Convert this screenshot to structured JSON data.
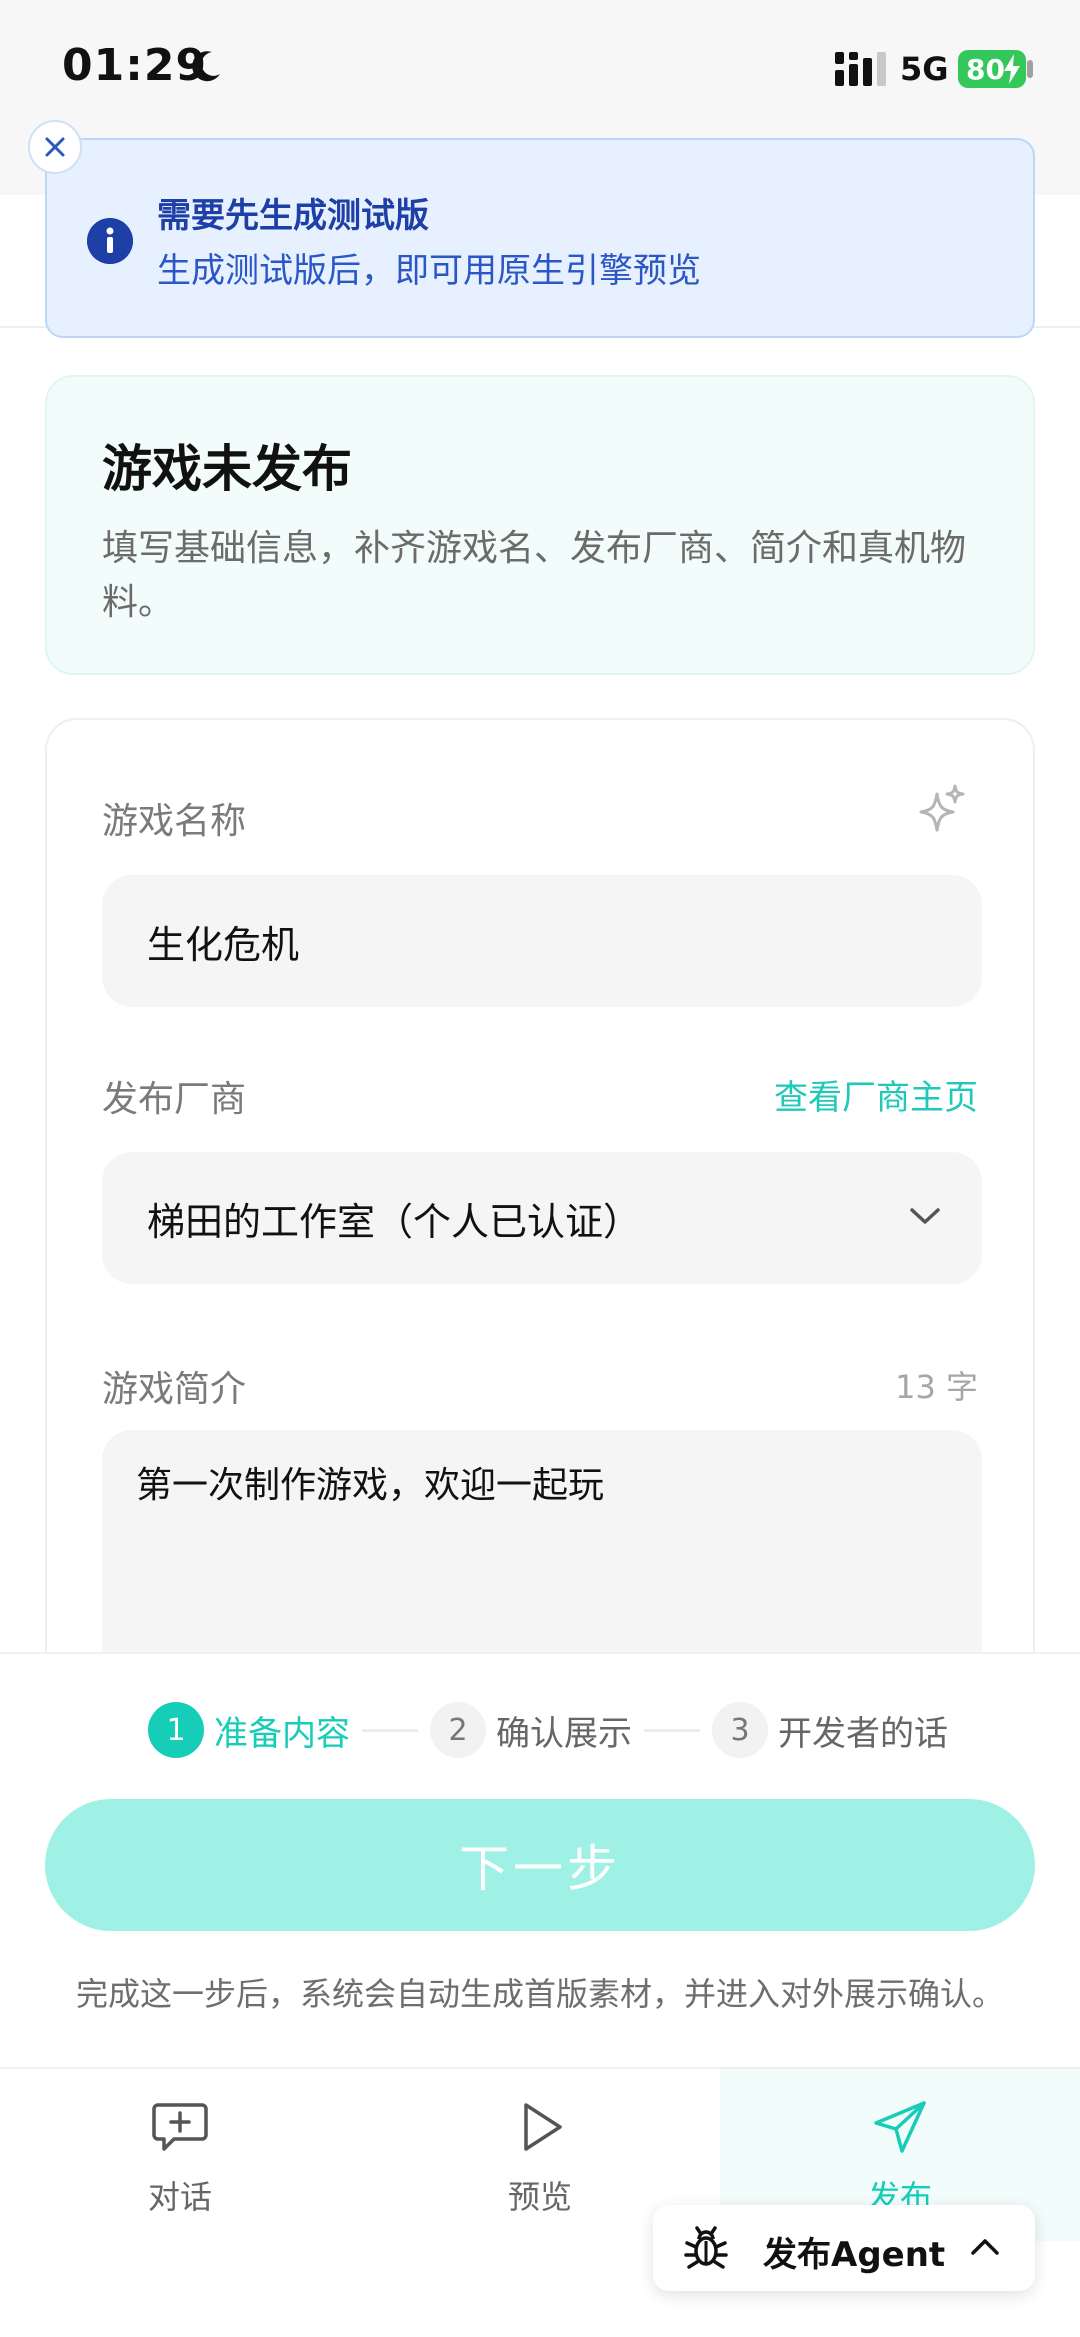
{
  "status_bar": {
    "time": "01:29",
    "network": "5G",
    "battery": "80"
  },
  "toast": {
    "title": "需要先生成测试版",
    "description": "生成测试版后，即可用原生引擎预览"
  },
  "status_card": {
    "title": "游戏未发布",
    "description": "填写基础信息，补齐游戏名、发布厂商、简介和真机物料。"
  },
  "form": {
    "game_name_label": "游戏名称",
    "game_name_value": "生化危机",
    "publisher_label": "发布厂商",
    "publisher_link": "查看厂商主页",
    "publisher_value": "梯田的工作室（个人已认证）",
    "intro_label": "游戏简介",
    "intro_count": "13 字",
    "intro_value": "第一次制作游戏，欢迎一起玩"
  },
  "steps": [
    {
      "num": "1",
      "label": "准备内容",
      "active": true
    },
    {
      "num": "2",
      "label": "确认展示",
      "active": false
    },
    {
      "num": "3",
      "label": "开发者的话",
      "active": false
    }
  ],
  "next_button": "下一步",
  "hint": "完成这一步后，系统会自动生成首版素材，并进入对外展示确认。",
  "tabs": [
    {
      "label": "对话",
      "icon": "chat-plus-icon"
    },
    {
      "label": "预览",
      "icon": "play-icon"
    },
    {
      "label": "发布",
      "icon": "paper-plane-icon"
    }
  ],
  "agent_pill": {
    "label": "发布Agent",
    "icon": "bug-icon"
  },
  "colors": {
    "accent": "#16cdb7",
    "accent_light": "#9ff0e5",
    "toast_bg": "#e6f0ff",
    "toast_text": "#1d3fa6"
  }
}
